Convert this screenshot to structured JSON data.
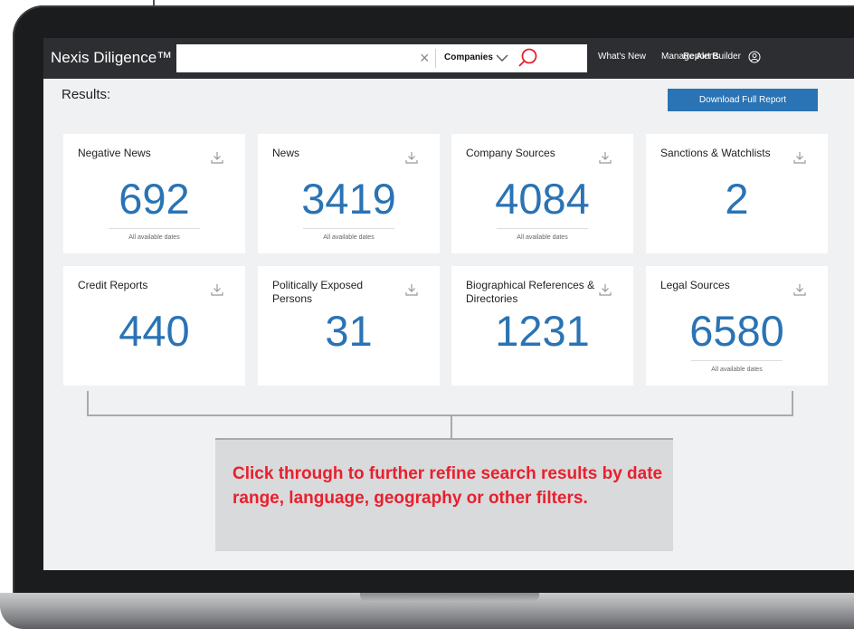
{
  "app": {
    "title": "Nexis Diligence™"
  },
  "search": {
    "value": "",
    "filter": "Companies"
  },
  "nav": {
    "whats_new": "What's New",
    "manage_alerts": "Manage Alerts",
    "report_builder": "Report Builder"
  },
  "results": {
    "title": "Results:",
    "download_label": "Download Full Report"
  },
  "cards": [
    {
      "label": "Negative News",
      "count": "692",
      "footnote": "All available dates"
    },
    {
      "label": "News",
      "count": "3419",
      "footnote": "All available dates"
    },
    {
      "label": "Company Sources",
      "count": "4084",
      "footnote": "All available dates"
    },
    {
      "label": "Sanctions & Watchlists",
      "count": "2",
      "footnote": ""
    },
    {
      "label": "Credit Reports",
      "count": "440",
      "footnote": ""
    },
    {
      "label": "Politically Exposed Persons",
      "count": "31",
      "footnote": ""
    },
    {
      "label": "Biographical References & Directories",
      "count": "1231",
      "footnote": ""
    },
    {
      "label": "Legal Sources",
      "count": "6580",
      "footnote": "All available dates"
    }
  ],
  "callout": {
    "text": "Click through to further refine search results by date range, language, geography or other filters."
  },
  "colors": {
    "accent": "#2a73b4",
    "callout_text": "#e8202d",
    "navbar": "#2d2e31"
  },
  "icons": {
    "clear": "close-icon",
    "dropdown": "chevron-down-icon",
    "search": "search-icon",
    "user": "user-icon",
    "download": "download-icon"
  }
}
